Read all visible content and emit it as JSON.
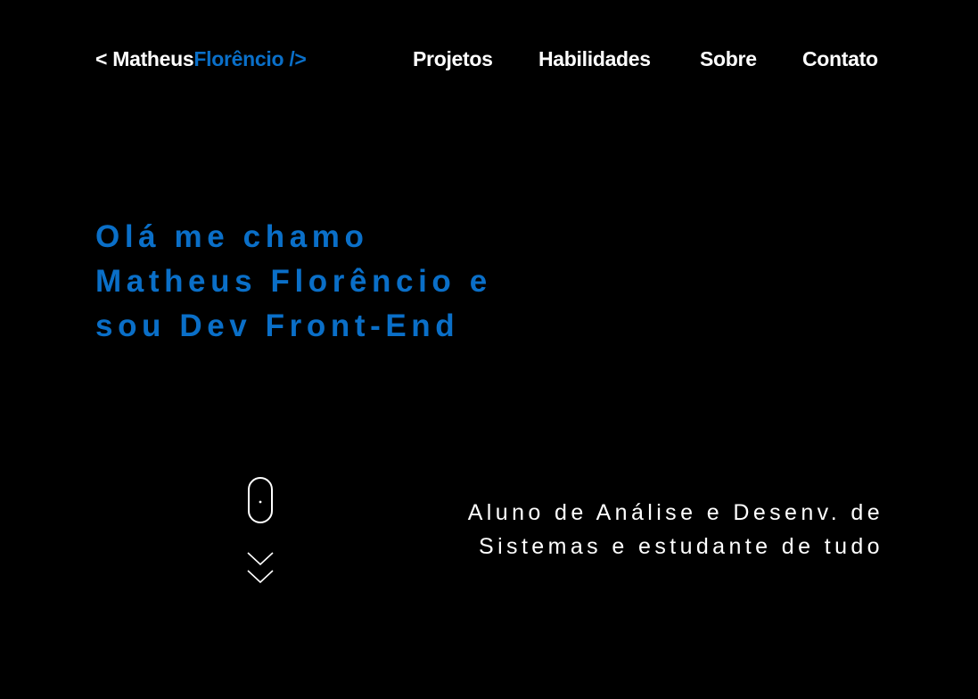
{
  "logo": {
    "prefix": "< Matheus",
    "suffix": "Florêncio />"
  },
  "nav": {
    "items": [
      {
        "label": "Projetos"
      },
      {
        "label": "Habilidades"
      },
      {
        "label": "Sobre"
      },
      {
        "label": "Contato"
      }
    ]
  },
  "hero": {
    "lines": [
      "Olá me chamo",
      "Matheus Florêncio e",
      "sou Dev Front-End"
    ]
  },
  "scroll_indicator": {
    "icons": [
      "mouse-icon",
      "double-chevron-down-icon"
    ]
  },
  "tagline": {
    "lines": [
      "Aluno de Análise e Desenv. de",
      "Sistemas e estudante de tudo"
    ]
  },
  "colors": {
    "background": "#000000",
    "accent": "#0a6fc8",
    "text": "#ffffff"
  }
}
